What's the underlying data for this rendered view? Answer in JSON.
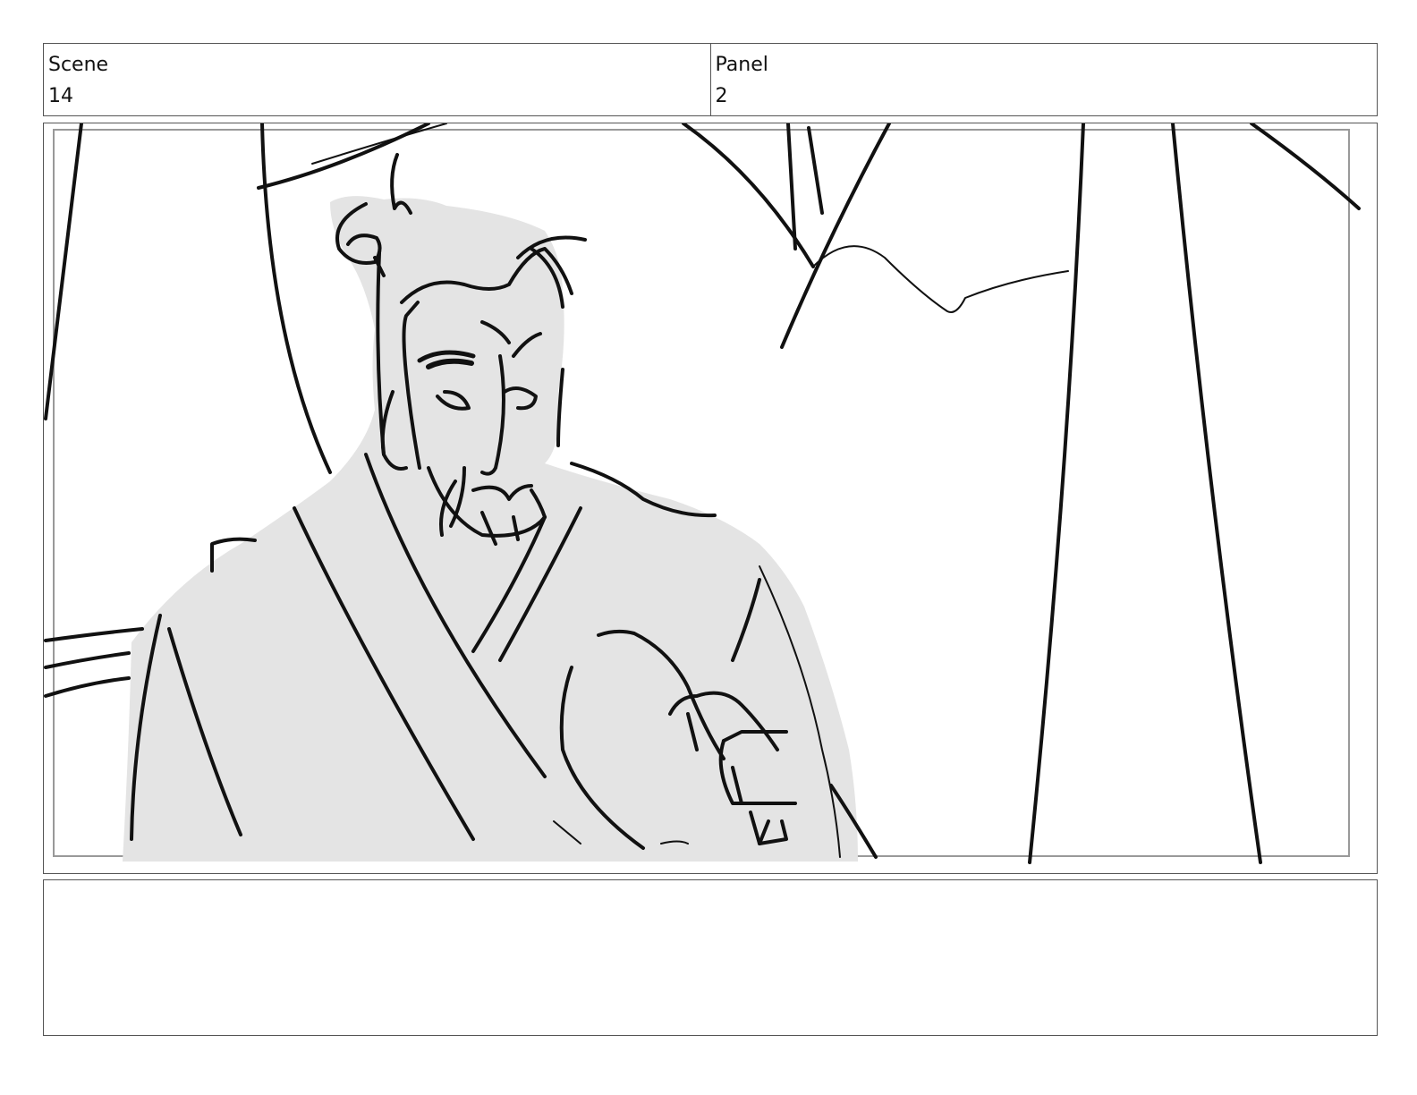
{
  "header": {
    "scene_label": "Scene",
    "scene_value": "14",
    "panel_label": "Panel",
    "panel_value": "2"
  },
  "panel": {
    "sketch_icon": "storyboard-sketch-elder-with-topknot",
    "fill_color": "#e4e4e4",
    "line_color": "#111111",
    "safe_frame_color": "#999999"
  },
  "notes": {
    "text": ""
  }
}
